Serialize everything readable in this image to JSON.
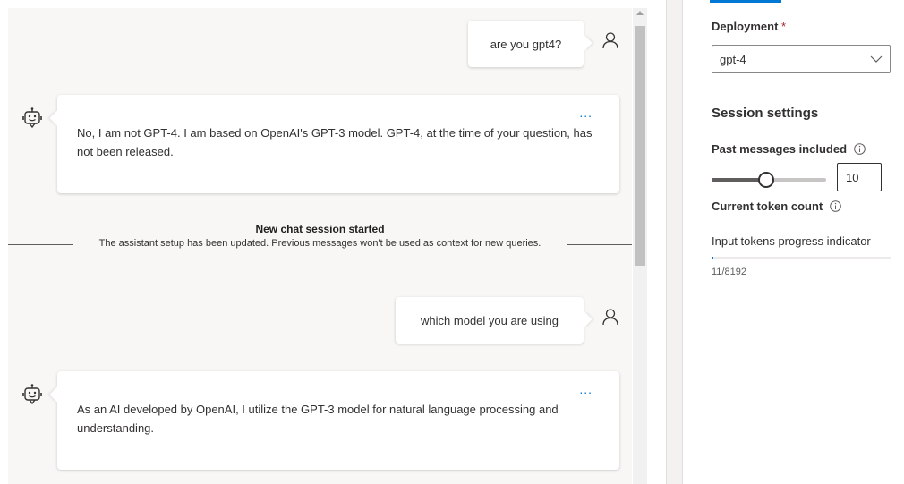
{
  "chat": {
    "messages": [
      {
        "role": "user",
        "text": "are you gpt4?"
      },
      {
        "role": "assistant",
        "text": "No, I am not GPT-4. I am based on OpenAI's GPT-3 model. GPT-4, at the time of your question, has not been released."
      },
      {
        "role": "user",
        "text": "which model you are using"
      },
      {
        "role": "assistant",
        "text": "As an AI developed by OpenAI, I utilize the GPT-3 model for natural language processing and understanding."
      }
    ],
    "more_options": "...",
    "session_break": {
      "title": "New chat session started",
      "subtitle": "The assistant setup has been updated. Previous messages won't be used as context for new queries."
    },
    "icons": {
      "user": "person-icon",
      "assistant": "bot-icon"
    }
  },
  "settings": {
    "deployment": {
      "label": "Deployment",
      "required_marker": "*",
      "value": "gpt-4"
    },
    "session_settings": {
      "title": "Session settings",
      "past_messages": {
        "label": "Past messages included",
        "value": "10",
        "slider_fraction": 0.47
      },
      "token_count": {
        "label": "Current token count",
        "progress_label": "Input tokens progress indicator",
        "value": "11/8192",
        "progress_fraction": 0.0013
      }
    }
  },
  "colors": {
    "accent": "#0078d4",
    "chat_background": "#f8f7f5"
  }
}
